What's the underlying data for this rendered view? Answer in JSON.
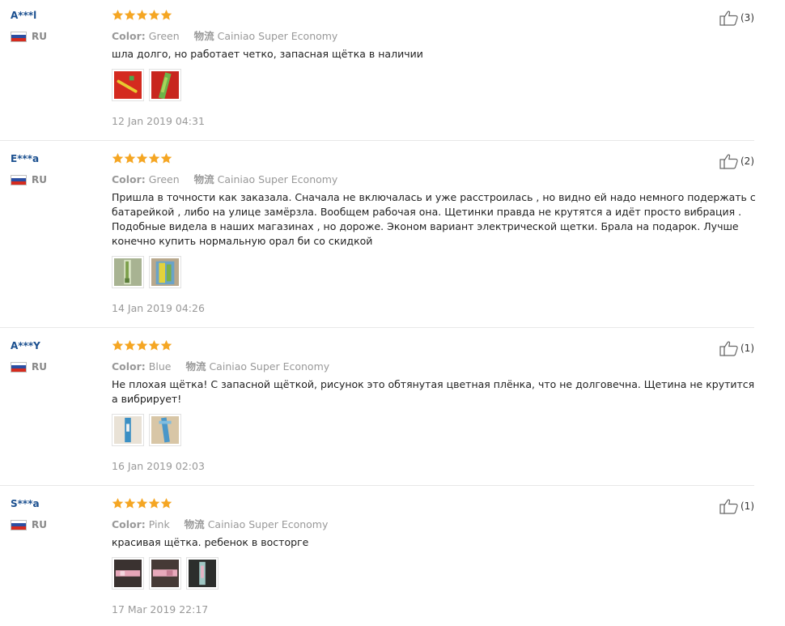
{
  "reviews": [
    {
      "user": "A***l",
      "country": "RU",
      "rating": 5,
      "color_label": "Color:",
      "color_value": "Green",
      "shipping_label": "物流",
      "shipping_value": "Cainiao Super Economy",
      "text": "шла долго, но работает четко, запасная щётка в наличии",
      "photos": [
        "red-green",
        "red-green-2"
      ],
      "date": "12 Jan 2019 04:31",
      "helpful": "(3)"
    },
    {
      "user": "E***a",
      "country": "RU",
      "rating": 5,
      "color_label": "Color:",
      "color_value": "Green",
      "shipping_label": "物流",
      "shipping_value": "Cainiao Super Economy",
      "text": "Пришла в точности как заказала. Сначала не включалась и уже расстроилась , но видно ей надо немного подержать с батарейкой , либо на улице замёрзла. Вообщем рабочая она. Щетинки правда не крутятся а идёт просто вибрация . Подобные видела в наших магазинах , но дороже. Эконом вариант электрической щетки. Брала на подарок. Лучше конечно купить нормальную орал би со скидкой",
      "photos": [
        "green-brush",
        "green-box"
      ],
      "date": "14 Jan 2019 04:26",
      "helpful": "(2)"
    },
    {
      "user": "A***Y",
      "country": "RU",
      "rating": 5,
      "color_label": "Color:",
      "color_value": "Blue",
      "shipping_label": "物流",
      "shipping_value": "Cainiao Super Economy",
      "text": "Не плохая щётка! С запасной щёткой, рисунок это обтянутая цветная плёнка, что не долговечна. Щетина не крутится а вибрирует!",
      "photos": [
        "blue-brush",
        "blue-brush-2"
      ],
      "date": "16 Jan 2019 02:03",
      "helpful": "(1)"
    },
    {
      "user": "S***a",
      "country": "RU",
      "rating": 5,
      "color_label": "Color:",
      "color_value": "Pink",
      "shipping_label": "物流",
      "shipping_value": "Cainiao Super Economy",
      "text": "красивая щётка. ребенок в восторге",
      "photos": [
        "pink-brush",
        "pink-brush-2",
        "pink-brush-3"
      ],
      "date": "17 Mar 2019 22:17",
      "helpful": "(1)"
    }
  ],
  "colors": {
    "star": "#f5a623",
    "username": "#1a4f8f"
  }
}
